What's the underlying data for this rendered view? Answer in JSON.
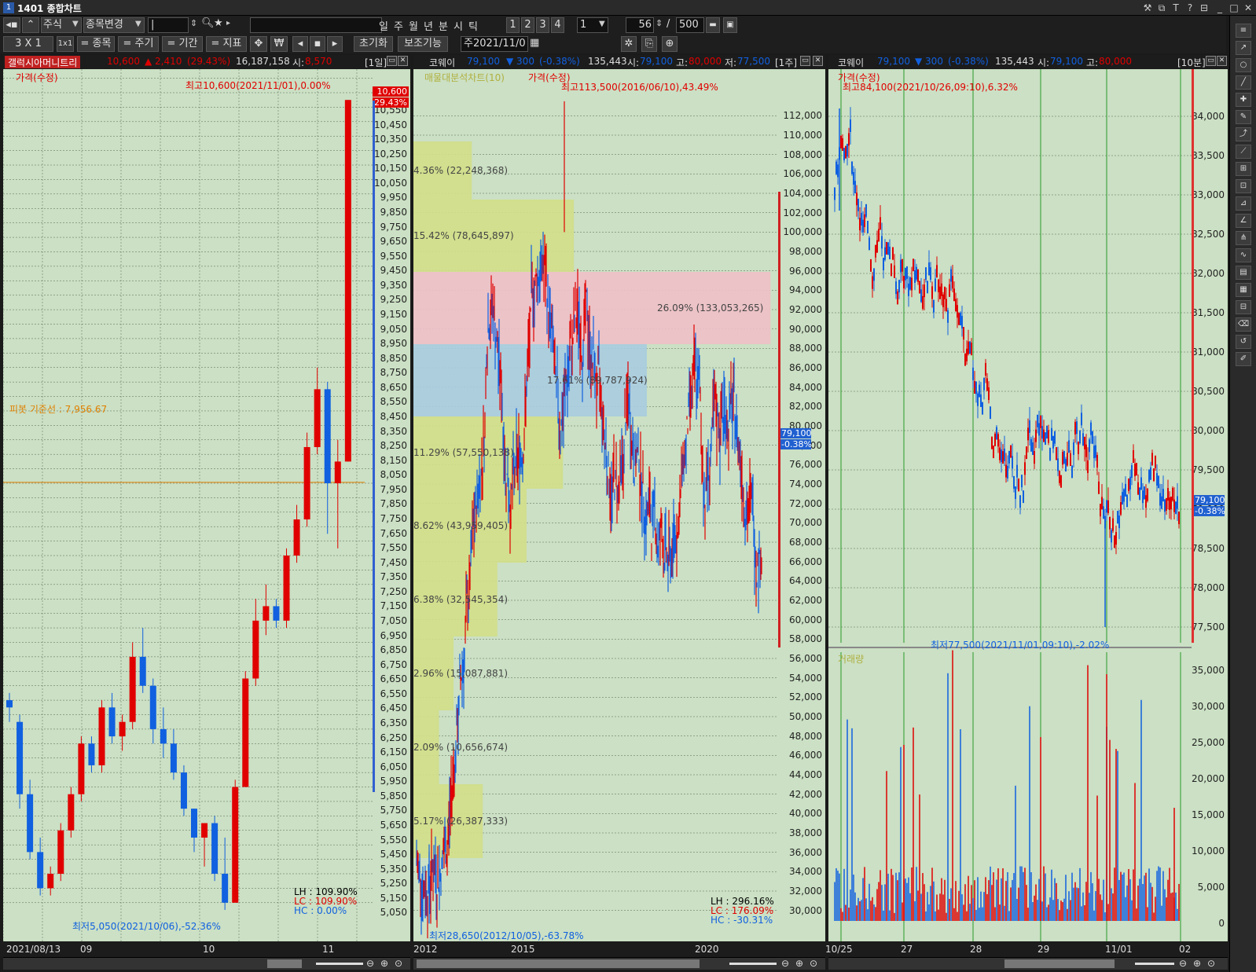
{
  "window": {
    "title": "1401 종합차트",
    "icon": "chart-app-icon"
  },
  "toolbar1": {
    "market": "주식",
    "change_stock": "종목변경",
    "code_value": "|",
    "periods": [
      "일",
      "주",
      "월",
      "년",
      "분",
      "시",
      "틱"
    ],
    "layouts": [
      "1",
      "2",
      "3",
      "4"
    ],
    "layout_select": "1",
    "count": "56",
    "total": "500"
  },
  "toolbar2": {
    "grid": "3 X 1",
    "buttons": [
      "= 종목",
      "= 주기",
      "= 기간",
      "= 지표"
    ],
    "reset": "초기화",
    "aux": "보조기능",
    "date": "주2021/11/0"
  },
  "p1": {
    "name": "갤럭시아머니트리",
    "price": "10,600",
    "change": "▲ 2,410",
    "pct": "(29.43%)",
    "volume": "16,187,158",
    "open_label": "시:",
    "open": "8,570",
    "period": "[1일]",
    "legend": "가격(수정)",
    "high_note": "최고10,600(2021/11/01),0.00%",
    "low_note": "최저5,050(2021/10/06),-52.36%",
    "pivot_note": "피봇 기준선 : 7,956.67",
    "lh": "LH :  109.90%",
    "lc": "LC :  109.90%",
    "hc": "HC :    0.00%",
    "tag_price": "10,600",
    "tag_pct": "29.43%",
    "y_labels": [
      "10,550",
      "10,450",
      "10,350",
      "10,250",
      "10,150",
      "10,050",
      "9,950",
      "9,850",
      "9,750",
      "9,650",
      "9,550",
      "9,450",
      "9,350",
      "9,250",
      "9,150",
      "9,050",
      "8,950",
      "8,850",
      "8,750",
      "8,650",
      "8,550",
      "8,450",
      "8,350",
      "8,250",
      "8,150",
      "8,050",
      "7,950",
      "7,850",
      "7,750",
      "7,650",
      "7,550",
      "7,450",
      "7,350",
      "7,250",
      "7,150",
      "7,050",
      "6,950",
      "6,850",
      "6,750",
      "6,650",
      "6,550",
      "6,450",
      "6,350",
      "6,250",
      "6,150",
      "6,050",
      "5,950",
      "5,850",
      "5,750",
      "5,650",
      "5,550",
      "5,450",
      "5,350",
      "5,250",
      "5,150",
      "5,050"
    ],
    "x_labels": [
      "2021/08/13",
      "09",
      "10",
      "11"
    ]
  },
  "p2": {
    "name": "코웨이",
    "price": "79,100",
    "change": "▼ 300",
    "pct": "(-0.38%)",
    "volume": "135,443",
    "open_label": "시:",
    "open": "79,100",
    "high_label": "고:",
    "high": "80,000",
    "low_label": "저:",
    "low": "77,500",
    "period": "[1주]",
    "legend1": "매물대분석차트(10)",
    "legend2": "가격(수정)",
    "high_note": "최고113,500(2016/06/10),43.49%",
    "low_note": "최저28,650(2012/10/05),-63.78%",
    "lh": "LH :  296.16%",
    "lc": "LC :  176.09%",
    "hc": "HC :  -30.31%",
    "tag_price": "79,100",
    "tag_pct": "-0.38%",
    "profile": [
      "4.36% (22,248,368)",
      "15.42% (78,645,897)",
      "26.09% (133,053,265)",
      "17.61% (89,787,924)",
      "11.29% (57,550,138)",
      "8.62% (43,959,405)",
      "6.38% (32,545,354)",
      "2.96% (15,087,881)",
      "2.09% (10,656,674)",
      "5.17% (26,387,333)"
    ],
    "y_labels": [
      "112,000",
      "110,000",
      "108,000",
      "106,000",
      "104,000",
      "102,000",
      "100,000",
      "98,000",
      "96,000",
      "94,000",
      "92,000",
      "90,000",
      "88,000",
      "86,000",
      "84,000",
      "82,000",
      "80,000",
      "78,000",
      "76,000",
      "74,000",
      "72,000",
      "70,000",
      "68,000",
      "66,000",
      "64,000",
      "62,000",
      "60,000",
      "58,000",
      "56,000",
      "54,000",
      "52,000",
      "50,000",
      "48,000",
      "46,000",
      "44,000",
      "42,000",
      "40,000",
      "38,000",
      "36,000",
      "34,000",
      "32,000",
      "30,000"
    ],
    "x_labels": [
      "2012",
      "2015",
      "2020"
    ]
  },
  "p3": {
    "name": "코웨이",
    "price": "79,100",
    "change": "▼ 300",
    "pct": "(-0.38%)",
    "volume": "135,443",
    "open_label": "시:",
    "open": "79,100",
    "high_label": "고:",
    "high": "80,000",
    "period": "[10분]",
    "legend": "가격(수정)",
    "high_note": "최고84,100(2021/10/26,09:10),6.32%",
    "low_note": "최저77,500(2021/11/01,09:10),-2.02%",
    "vol_legend": "거래량",
    "tag_price": "79,100",
    "tag_pct": "-0.38%",
    "y_labels": [
      "84,000",
      "83,500",
      "83,000",
      "82,500",
      "82,000",
      "81,500",
      "81,000",
      "80,500",
      "80,000",
      "79,500",
      "79,000",
      "78,500",
      "78,000",
      "77,500"
    ],
    "vol_labels": [
      "35,000",
      "30,000",
      "25,000",
      "20,000",
      "15,000",
      "10,000",
      "5,000",
      "0"
    ],
    "x_labels": [
      "10/25",
      "27",
      "28",
      "29",
      "11/01",
      "02"
    ]
  },
  "colors": {
    "up": "#e00000",
    "down": "#1060e0",
    "bg": "#cbe0c4"
  }
}
